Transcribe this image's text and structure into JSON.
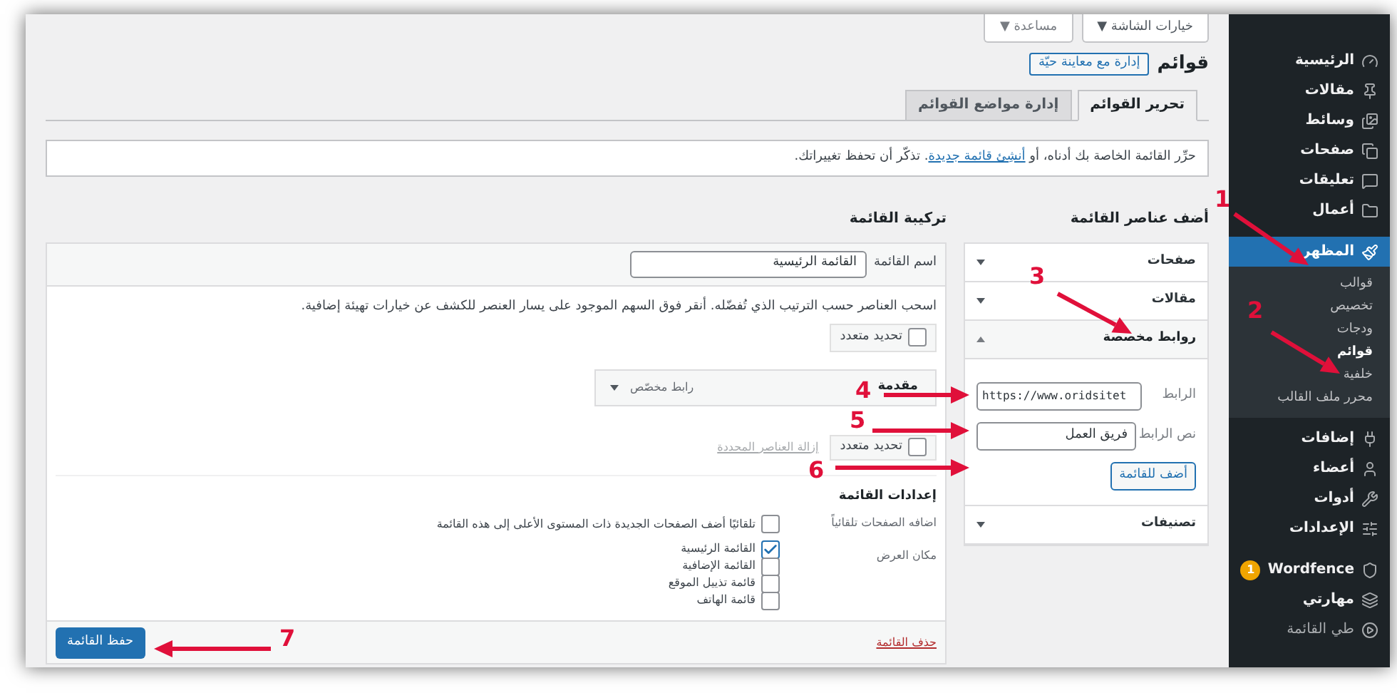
{
  "top_buttons": [
    {
      "label": "خيارات الشاشة ▼"
    },
    {
      "label": "مساعدة ▼"
    }
  ],
  "page_title": "قوائم",
  "live_button": "إدارة مع معاينة حيّة",
  "tabs": [
    {
      "label": "تحرير القوائم",
      "selected": true
    },
    {
      "label": "إدارة مواضع القوائم",
      "selected": false
    }
  ],
  "notice": {
    "before": "حرِّر القائمة الخاصة بك أدناه، أو",
    "link": "أنشِئ قائمة جديدة",
    "after": ". تذكّر أن تحفظ تغييراتك."
  },
  "add_items": {
    "heading": "أضف عناصر القائمة",
    "sections": [
      {
        "title": "صفحات",
        "expanded": false
      },
      {
        "title": "مقالات",
        "expanded": false
      },
      {
        "title": "روابط مخصصة",
        "expanded": true
      },
      {
        "title": "تصنيفات",
        "expanded": false
      }
    ],
    "url_label": "الرابط",
    "url_value": "https://www.oridsitet",
    "text_label": "نص الرابط",
    "text_value": "فريق العمل",
    "add_button": "أضف للقائمة"
  },
  "structure": {
    "heading": "تركيبة القائمة",
    "name_label": "اسم القائمة",
    "name_value": "القائمة الرئيسية",
    "instructions": "اسحب العناصر حسب الترتيب الذي تُفضّله. أنقر فوق السهم الموجود على يسار العنصر للكشف عن خيارات تهيئة إضافية.",
    "bulk_select": {
      "label": "تحديد متعدد",
      "checked": false
    },
    "menu_items": [
      {
        "title": "مقدمة",
        "type": "رابط مخصّص"
      }
    ],
    "bulk_select_2": {
      "label": "تحديد متعدد",
      "checked": false
    },
    "remove_link": "إزالة العناصر المحددة",
    "settings_heading": "إعدادات القائمة",
    "auto_add_label": "اضافه الصفحات تلقائياً",
    "auto_add": {
      "label": "تلقائيًا أضف الصفحات الجديدة ذات المستوى الأعلى إلى هذه القائمة",
      "checked": false
    },
    "location_label": "مكان العرض",
    "locations": [
      {
        "label": "القائمة الرئيسية",
        "checked": true
      },
      {
        "label": "القائمة الإضافية",
        "checked": false
      },
      {
        "label": "قائمة تذييل الموقع",
        "checked": false
      },
      {
        "label": "قائمة الهاتف",
        "checked": false
      }
    ],
    "delete_link": "حذف القائمة",
    "save_button": "حفظ القائمة"
  },
  "sidebar": {
    "items": [
      {
        "label": "الرئيسية",
        "selected": false
      },
      {
        "label": "مقالات",
        "selected": false
      },
      {
        "label": "وسائط",
        "selected": false
      },
      {
        "label": "صفحات",
        "selected": false
      },
      {
        "label": "تعليقات",
        "selected": false
      },
      {
        "label": "أعمال",
        "selected": false
      },
      {
        "label": "المظهر",
        "selected": true,
        "children": [
          {
            "label": "قوالب",
            "selected": false
          },
          {
            "label": "تخصيص",
            "selected": false
          },
          {
            "label": "ودجات",
            "selected": false
          },
          {
            "label": "قوائم",
            "selected": true
          },
          {
            "label": "خلفية",
            "selected": false
          },
          {
            "label": "محرر ملف القالب",
            "selected": false
          }
        ]
      },
      {
        "label": "إضافات",
        "selected": false
      },
      {
        "label": "أعضاء",
        "selected": false
      },
      {
        "label": "أدوات",
        "selected": false
      },
      {
        "label": "الإعدادات",
        "selected": false
      },
      {
        "label": "Wordfence",
        "selected": false,
        "badge": "1"
      },
      {
        "label": "مهارتي",
        "selected": false
      },
      {
        "label": "طي القائمة",
        "selected": false
      }
    ]
  },
  "annotations": [
    {
      "number": "1"
    },
    {
      "number": "2"
    },
    {
      "number": "3"
    },
    {
      "number": "4"
    },
    {
      "number": "5"
    },
    {
      "number": "6"
    },
    {
      "number": "7"
    }
  ]
}
